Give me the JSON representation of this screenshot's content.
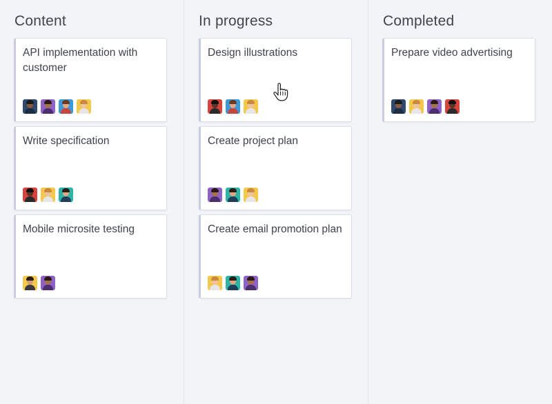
{
  "columns": [
    {
      "title": "Content",
      "cards": [
        {
          "title": "API implementation with customer",
          "avatars": [
            "avatar-man-dark-blue",
            "avatar-man-purple",
            "avatar-man-blue",
            "avatar-woman-yellow"
          ]
        },
        {
          "title": "Write specification",
          "avatars": [
            "avatar-man-red",
            "avatar-woman-yellow",
            "avatar-man-teal"
          ]
        },
        {
          "title": "Mobile microsite testing",
          "avatars": [
            "avatar-man-yellow",
            "avatar-man-purple"
          ]
        }
      ]
    },
    {
      "title": "In progress",
      "cards": [
        {
          "title": "Design illustrations",
          "avatars": [
            "avatar-man-red",
            "avatar-man-blue",
            "avatar-woman-yellow"
          ]
        },
        {
          "title": "Create project plan",
          "avatars": [
            "avatar-man-purple",
            "avatar-man-teal",
            "avatar-woman-yellow"
          ]
        },
        {
          "title": "Create email promotion plan",
          "avatars": [
            "avatar-woman-yellow",
            "avatar-man-teal",
            "avatar-man-purple"
          ]
        }
      ]
    },
    {
      "title": "Completed",
      "cards": [
        {
          "title": "Prepare video advertising",
          "avatars": [
            "avatar-man-dark-blue",
            "avatar-woman-yellow",
            "avatar-man-purple",
            "avatar-man-red"
          ]
        }
      ]
    }
  ],
  "avatar_colors": {
    "avatar-man-dark-blue": {
      "bg": "#2f4a6e",
      "skin": "#8a5a3c",
      "hair": "#1b1b1b",
      "shirt": "#1d2d44"
    },
    "avatar-man-purple": {
      "bg": "#8e63c4",
      "skin": "#a8714d",
      "hair": "#2a1c14",
      "shirt": "#4b2f6e"
    },
    "avatar-man-blue": {
      "bg": "#3c9ad8",
      "skin": "#e2a985",
      "hair": "#6b3b22",
      "shirt": "#c5463c"
    },
    "avatar-woman-yellow": {
      "bg": "#f2c94c",
      "skin": "#f0c2a2",
      "hair": "#c98a3f",
      "shirt": "#e6e6e6"
    },
    "avatar-man-red": {
      "bg": "#d6453d",
      "skin": "#5a3526",
      "hair": "#111111",
      "shirt": "#2b2b2b"
    },
    "avatar-man-teal": {
      "bg": "#2fb5a8",
      "skin": "#e0a882",
      "hair": "#2a1e18",
      "shirt": "#1f3f5a"
    },
    "avatar-man-yellow": {
      "bg": "#f2c94c",
      "skin": "#d49a72",
      "hair": "#2b1f16",
      "shirt": "#3b3b3b"
    }
  },
  "cursor_icon": "hand-pointer-icon"
}
